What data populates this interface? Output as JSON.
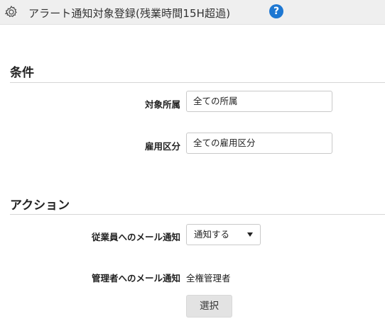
{
  "header": {
    "title": "アラート通知対象登録(残業時間15H超過)",
    "help_icon": "?"
  },
  "conditions": {
    "section_title": "条件",
    "target_department": {
      "label": "対象所属",
      "value": "全ての所属"
    },
    "employment_type": {
      "label": "雇用区分",
      "value": "全ての雇用区分"
    }
  },
  "actions": {
    "section_title": "アクション",
    "employee_email": {
      "label": "従業員へのメール通知",
      "selected": "通知する"
    },
    "manager_email": {
      "label": "管理者へのメール通知",
      "value": "全権管理者"
    },
    "select_button": "選択"
  },
  "colors": {
    "accent": "#1d77d2",
    "header_bg": "#efefef"
  }
}
